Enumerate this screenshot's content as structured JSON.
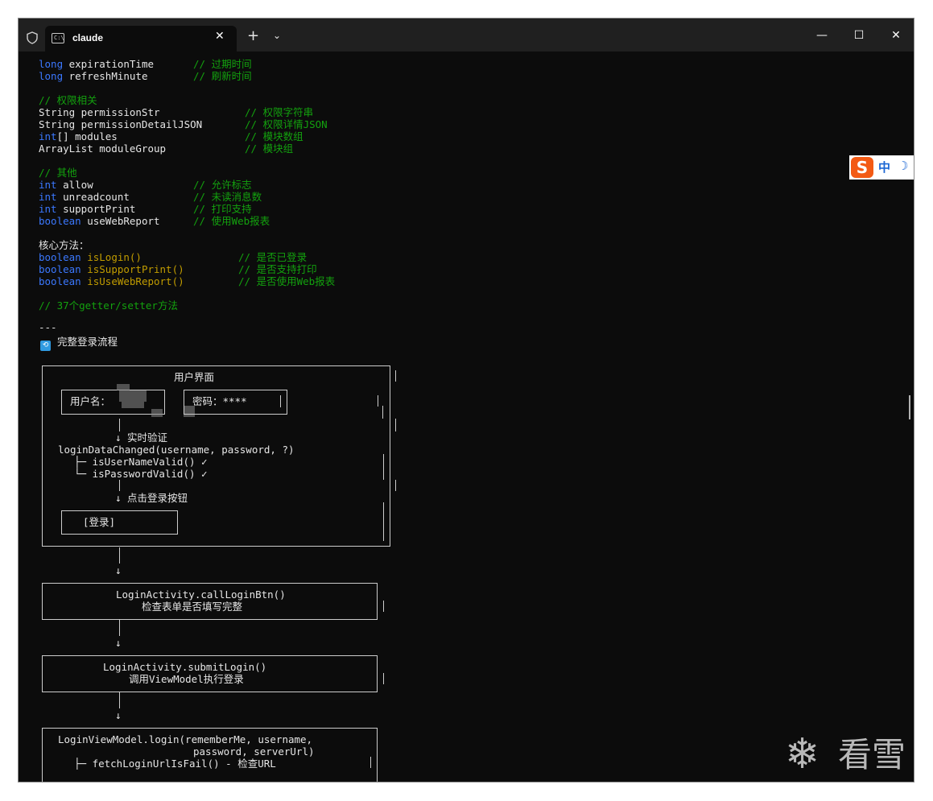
{
  "window": {
    "tab_title": "claude",
    "tab_close": "✕",
    "new_tab": "+",
    "dropdown": "⌄",
    "minimize": "—",
    "maximize": "☐",
    "close": "✕",
    "shield_icon": "shield-icon",
    "terminal_icon": "terminal-icon"
  },
  "code": {
    "l1": {
      "t": "long",
      "n": " expirationTime",
      "c": "// 过期时间"
    },
    "l2": {
      "t": "long",
      "n": " refreshMinute",
      "c": "// 刷新时间"
    },
    "sec_permission": "// 权限相关",
    "l3": {
      "n": "String permissionStr",
      "c": "// 权限字符串"
    },
    "l4": {
      "n": "String permissionDetailJSON",
      "c": "// 权限详情JSON"
    },
    "l5": {
      "t": "int",
      "n": "[] modules",
      "c": "// 模块数组"
    },
    "l6": {
      "n": "ArrayList moduleGroup",
      "c": "// 模块组"
    },
    "sec_other": "// 其他",
    "l7": {
      "t": "int",
      "n": " allow",
      "c": "// 允许标志"
    },
    "l8": {
      "t": "int",
      "n": " unreadcount",
      "c": "// 未读消息数"
    },
    "l9": {
      "t": "int",
      "n": " supportPrint",
      "c": "// 打印支持"
    },
    "l10": {
      "t": "boolean",
      "n": " useWebReport",
      "c": "// 使用Web报表"
    },
    "core_methods": "核心方法：",
    "m1": {
      "t": "boolean",
      "f": " isLogin()",
      "c": "// 是否已登录"
    },
    "m2": {
      "t": "boolean",
      "f": " isSupportPrint()",
      "c": "// 是否支持打印"
    },
    "m3": {
      "t": "boolean",
      "f": " isUseWebReport()",
      "c": "// 是否使用Web报表"
    },
    "getters": "// 37个getter/setter方法",
    "hr": "---",
    "flow_heading": "完整登录流程",
    "flow_icon": "🔄"
  },
  "flow": {
    "ui_title": "用户界面",
    "username_label": "用户名：",
    "password_label": "密码：****",
    "realtime": "↓ 实时验证",
    "changed": "loginDataChanged(username, password, ?)",
    "valid1": "├─ isUserNameValid() ✓",
    "valid2": "└─ isPasswordValid() ✓",
    "click": "↓ 点击登录按钮",
    "login_btn": "[登录]",
    "arrow": "↓",
    "call_title": "LoginActivity.callLoginBtn()",
    "call_desc": "检查表单是否填写完整",
    "submit_title": "LoginActivity.submitLogin()",
    "submit_desc": "调用ViewModel执行登录",
    "vm_line1": "LoginViewModel.login(rememberMe, username,",
    "vm_line2": "password, serverUrl)",
    "vm_line3": "├─ fetchLoginUrlIsFail() - 检查URL"
  },
  "ime": {
    "logo": "S",
    "mode": "中",
    "moon": "☽"
  },
  "watermark": {
    "text": "看雪",
    "icon": "snowflake-icon"
  }
}
